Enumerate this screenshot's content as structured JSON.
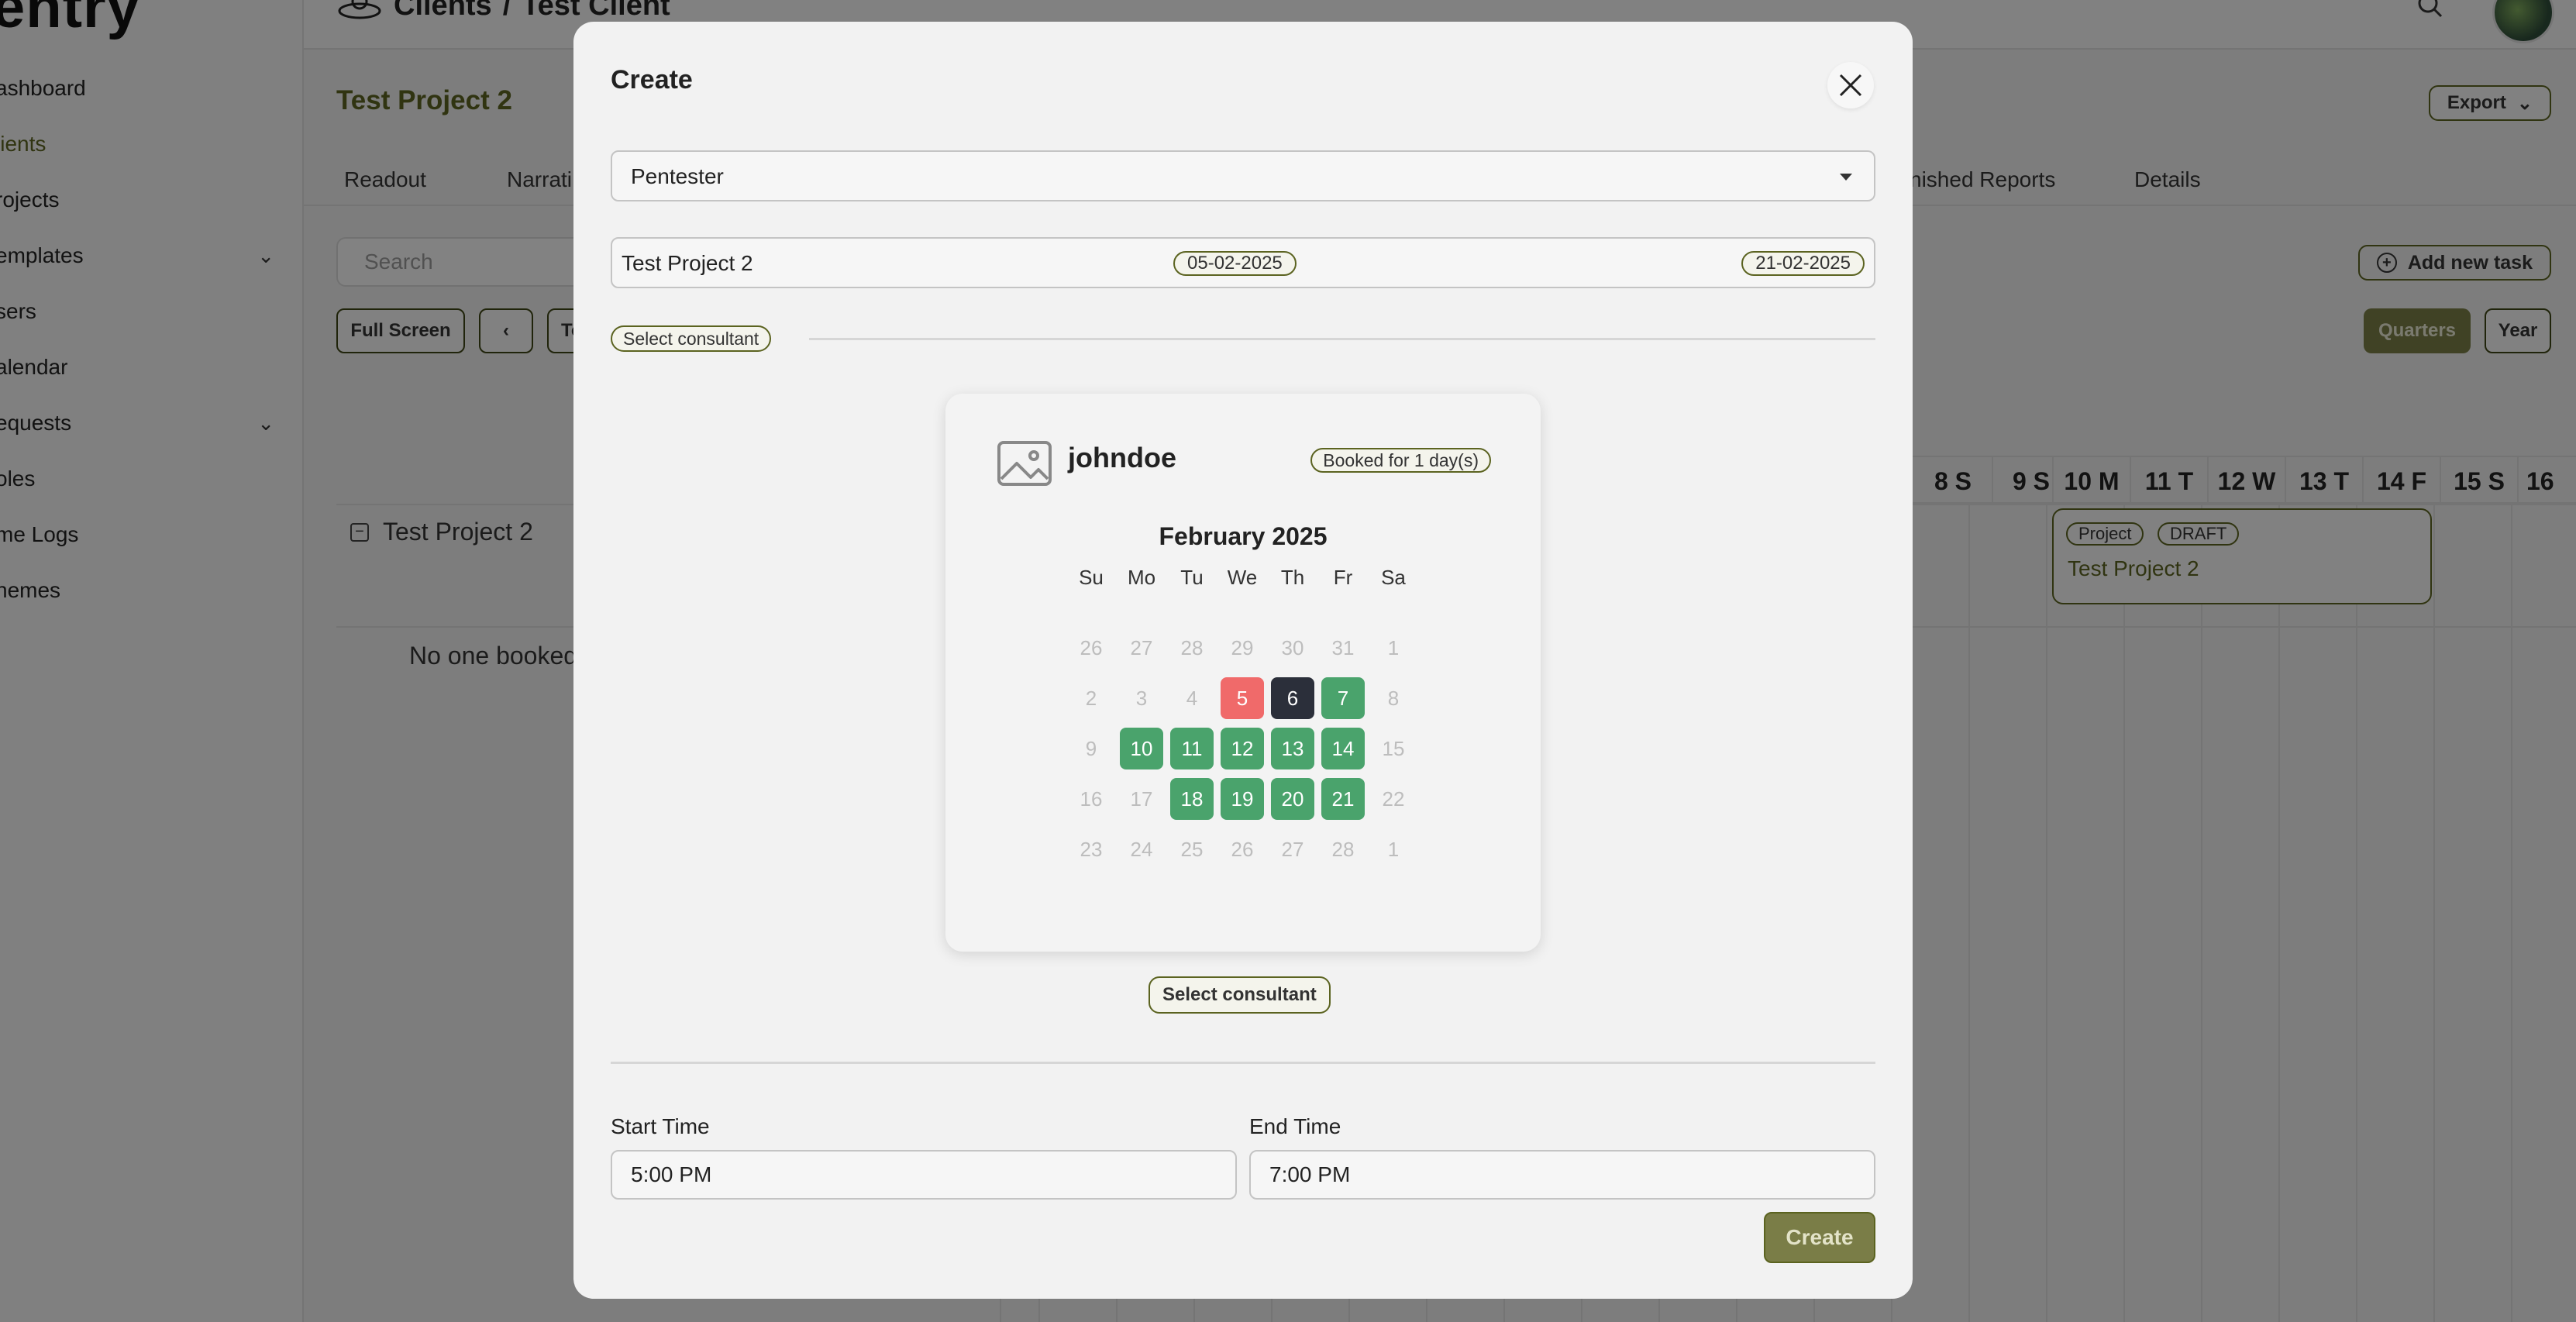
{
  "app": {
    "logo_text": "entry",
    "breadcrumb": {
      "parent": "Clients",
      "separator": "/",
      "current": "Test Client"
    }
  },
  "sidebar": {
    "items": [
      {
        "label": "ashboard"
      },
      {
        "label": "lients"
      },
      {
        "label": "rojects"
      },
      {
        "label": "emplates"
      },
      {
        "label": "sers"
      },
      {
        "label": "alendar"
      },
      {
        "label": "equests"
      },
      {
        "label": "oles"
      },
      {
        "label": "me Logs"
      },
      {
        "label": "hemes"
      }
    ]
  },
  "page": {
    "title": "Test Project 2",
    "export_label": "Export",
    "tabs": [
      "Readout",
      "Narrati",
      "nished Reports",
      "Details"
    ],
    "search_placeholder": "Search",
    "add_task_label": "Add new task",
    "full_screen_label": "Full Screen",
    "today_partial": "To",
    "quarters_label": "Quarters",
    "year_label": "Year",
    "gantt_days": [
      "8 S",
      "9 S",
      "10 M",
      "11 T",
      "12 W",
      "13 T",
      "14 F",
      "15 S",
      "16"
    ],
    "project_row": "Test Project 2",
    "no_one_booked": "No one booked",
    "task": {
      "tag1": "Project",
      "tag2": "DRAFT",
      "name": "Test Project 2"
    }
  },
  "modal": {
    "title": "Create",
    "role_select": "Pentester",
    "project": {
      "name": "Test Project 2",
      "start": "05-02-2025",
      "end": "21-02-2025"
    },
    "select_consultant_pill": "Select consultant",
    "consultant": {
      "username": "johndoe",
      "booked": "Booked for 1 day(s)",
      "month": "February 2025",
      "weekdays": [
        "Su",
        "Mo",
        "Tu",
        "We",
        "Th",
        "Fr",
        "Sa"
      ],
      "weeks": [
        [
          {
            "d": "26",
            "s": "muted"
          },
          {
            "d": "27",
            "s": "muted"
          },
          {
            "d": "28",
            "s": "muted"
          },
          {
            "d": "29",
            "s": "muted"
          },
          {
            "d": "30",
            "s": "muted"
          },
          {
            "d": "31",
            "s": "muted"
          },
          {
            "d": "1",
            "s": "muted"
          }
        ],
        [
          {
            "d": "2",
            "s": "muted"
          },
          {
            "d": "3",
            "s": "muted"
          },
          {
            "d": "4",
            "s": "muted"
          },
          {
            "d": "5",
            "s": "booked"
          },
          {
            "d": "6",
            "s": "selected"
          },
          {
            "d": "7",
            "s": "available"
          },
          {
            "d": "8",
            "s": "muted"
          }
        ],
        [
          {
            "d": "9",
            "s": "muted"
          },
          {
            "d": "10",
            "s": "available"
          },
          {
            "d": "11",
            "s": "available"
          },
          {
            "d": "12",
            "s": "available"
          },
          {
            "d": "13",
            "s": "available"
          },
          {
            "d": "14",
            "s": "available"
          },
          {
            "d": "15",
            "s": "muted"
          }
        ],
        [
          {
            "d": "16",
            "s": "muted"
          },
          {
            "d": "17",
            "s": "muted"
          },
          {
            "d": "18",
            "s": "available"
          },
          {
            "d": "19",
            "s": "available"
          },
          {
            "d": "20",
            "s": "available"
          },
          {
            "d": "21",
            "s": "available"
          },
          {
            "d": "22",
            "s": "muted"
          }
        ],
        [
          {
            "d": "23",
            "s": "muted"
          },
          {
            "d": "24",
            "s": "muted"
          },
          {
            "d": "25",
            "s": "muted"
          },
          {
            "d": "26",
            "s": "muted"
          },
          {
            "d": "27",
            "s": "muted"
          },
          {
            "d": "28",
            "s": "muted"
          },
          {
            "d": "1",
            "s": "muted"
          }
        ]
      ]
    },
    "select_consultant_button": "Select consultant",
    "start_time": {
      "label": "Start Time",
      "value": "5:00 PM"
    },
    "end_time": {
      "label": "End Time",
      "value": "7:00 PM"
    },
    "create_label": "Create"
  },
  "colors": {
    "accent": "#5b6320",
    "available": "#4aa36c",
    "booked": "#f06a6a",
    "selected": "#2b2f3a",
    "primary_button": "#7a7d47"
  }
}
